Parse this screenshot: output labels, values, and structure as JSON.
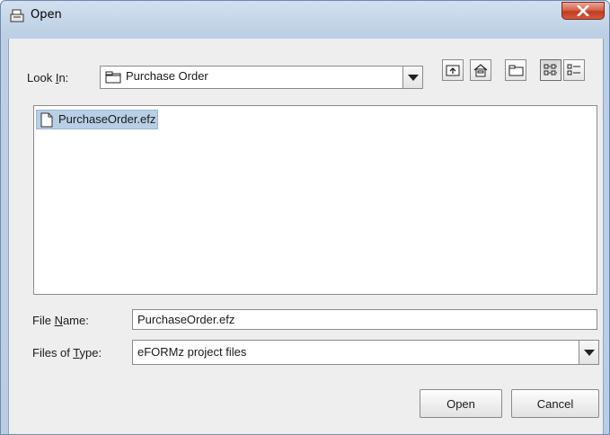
{
  "window": {
    "title": "Open",
    "close_glyph": "X"
  },
  "look_in": {
    "label_pre": "Look ",
    "label_mnemonic": "I",
    "label_post": "n:",
    "value": "Purchase Order",
    "icon": "folder-icon"
  },
  "toolbar": {
    "buttons": [
      {
        "name": "up-one-level-button",
        "icon": "up-folder-icon"
      },
      {
        "name": "home-button",
        "icon": "home-icon"
      },
      {
        "name": "new-folder-button",
        "icon": "new-folder-icon"
      },
      {
        "name": "list-view-button",
        "icon": "list-view-icon",
        "pressed": true
      },
      {
        "name": "details-view-button",
        "icon": "details-view-icon"
      }
    ]
  },
  "files": [
    {
      "name": "PurchaseOrder.efz",
      "icon": "file-icon",
      "selected": true
    }
  ],
  "file_name": {
    "label_pre": "File ",
    "label_mnemonic": "N",
    "label_post": "ame:",
    "value": "PurchaseOrder.efz"
  },
  "file_type": {
    "label_pre": "Files of ",
    "label_mnemonic": "T",
    "label_post": "ype:",
    "value": "eFORMz project files"
  },
  "buttons": {
    "open": "Open",
    "cancel": "Cancel"
  },
  "colors": {
    "selection": "#b8cfe5",
    "close_button": "#c23b20",
    "window_frame": "#bccfe5"
  }
}
